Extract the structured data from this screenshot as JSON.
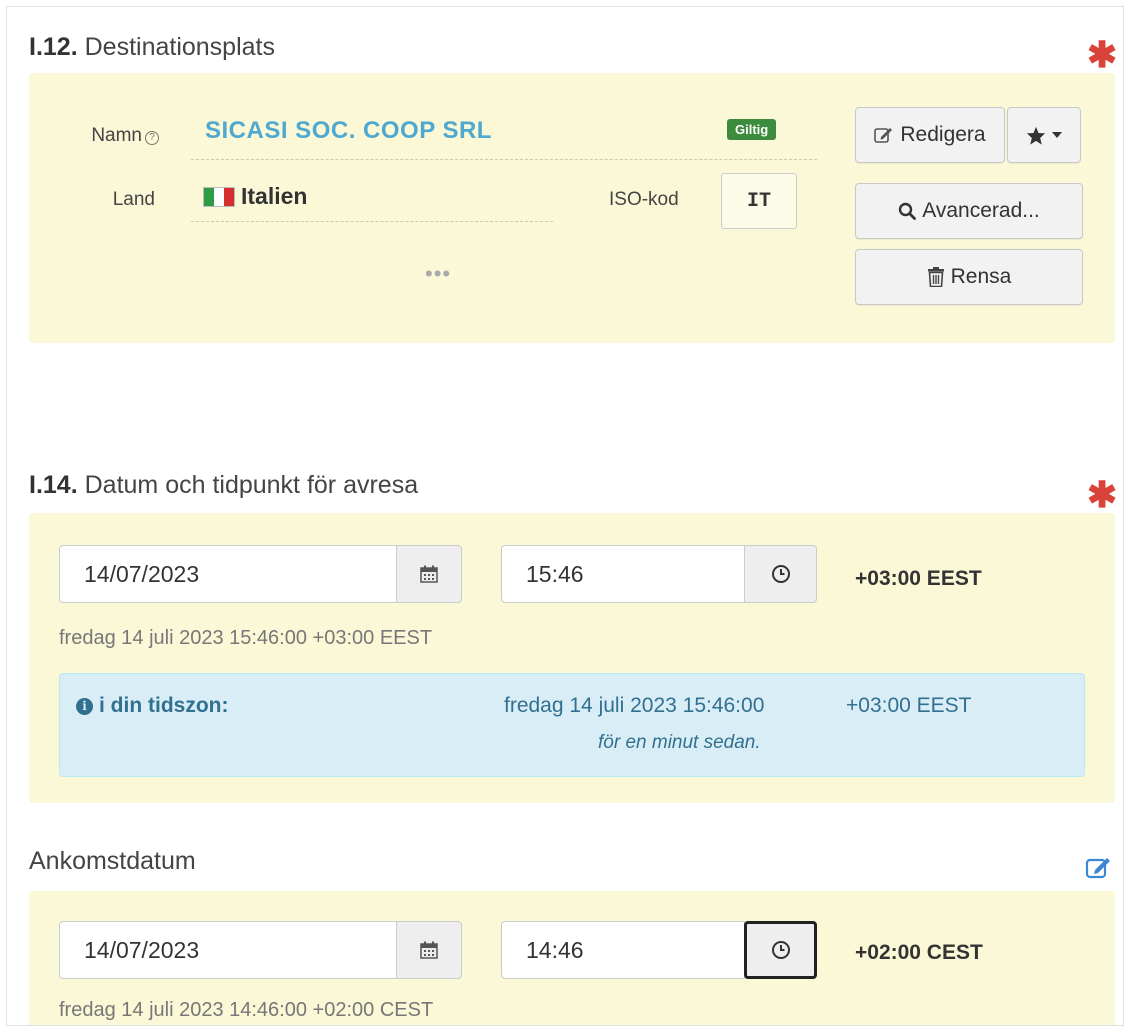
{
  "section12": {
    "number": "I.12.",
    "title": "Destinationsplats",
    "name_label": "Namn",
    "help_glyph": "?",
    "name_value": "SICASI SOC. COOP SRL",
    "status_badge": "Giltig",
    "country_label": "Land",
    "country_value": "Italien",
    "iso_label": "ISO-kod",
    "iso_value": "IT",
    "more": "•••",
    "edit_button": "Redigera",
    "advanced_button": "Avancerad...",
    "clear_button": "Rensa"
  },
  "section14": {
    "number": "I.14.",
    "title": "Datum och tidpunkt för avresa",
    "date_value": "14/07/2023",
    "time_value": "15:46",
    "timezone": "+03:00 EEST",
    "description": "fredag 14 juli 2023 15:46:00 +03:00 EEST",
    "info_label": "i din tidszon:",
    "info_icon_glyph": "i",
    "info_datetime": "fredag 14 juli 2023 15:46:00",
    "info_timezone": "+03:00 EEST",
    "info_relative": "för en minut sedan."
  },
  "arrival": {
    "title": "Ankomstdatum",
    "date_value": "14/07/2023",
    "time_value": "14:46",
    "timezone": "+02:00 CEST",
    "description": "fredag 14 juli 2023 14:46:00 +02:00 CEST"
  },
  "required_mark": "✱",
  "colors": {
    "panel": "#faf8d6",
    "required": "#d9433a",
    "name_link": "#4ea8cf",
    "badge": "#3d8b3d",
    "info_bg": "#d9edf7",
    "info_text": "#31708f",
    "edit_icon": "#3a87d6"
  }
}
